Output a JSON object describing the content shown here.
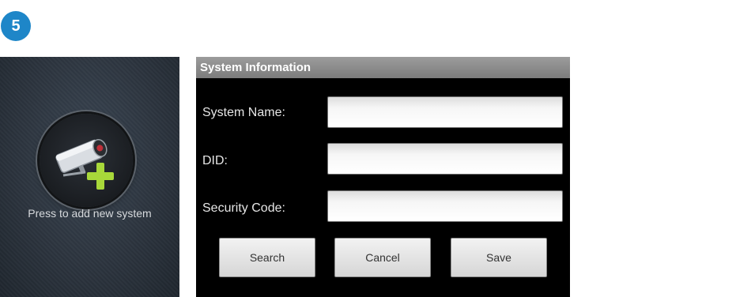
{
  "step": {
    "number": "5",
    "color": "#1e86c8"
  },
  "add_panel": {
    "label": "Press to add new system",
    "icon": "camera-add-icon"
  },
  "dialog": {
    "title": "System Information",
    "fields": [
      {
        "label": "System Name:",
        "value": ""
      },
      {
        "label": "DID:",
        "value": ""
      },
      {
        "label": "Security Code:",
        "value": ""
      }
    ],
    "buttons": {
      "search": "Search",
      "cancel": "Cancel",
      "save": "Save"
    }
  },
  "colors": {
    "dialog_bg": "#000000",
    "title_bar": "#8c8c8c",
    "plus_icon": "#a8d83a"
  }
}
